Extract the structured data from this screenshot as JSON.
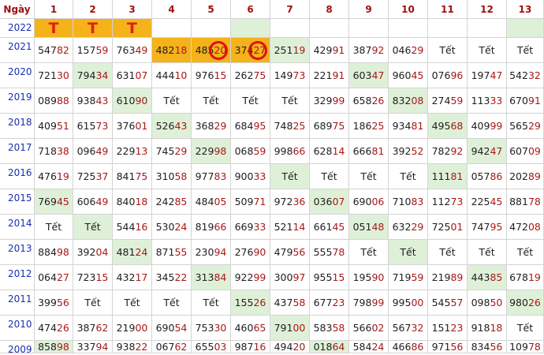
{
  "header": {
    "ngay_label": "Ngày",
    "days": [
      "1",
      "2",
      "3",
      "4",
      "5",
      "6",
      "7",
      "8",
      "9",
      "10",
      "11",
      "12",
      "13"
    ]
  },
  "colors": {
    "accent_text": "#a81818",
    "year_text": "#1a2fb0",
    "highlight_green": "#dff0d8",
    "highlight_orange": "#f5b21a",
    "circle": "#e01010"
  },
  "rows": [
    {
      "year": "2022",
      "cells": [
        {
          "t": "T",
          "c": "orange",
          "big": true
        },
        {
          "t": "T",
          "c": "orange",
          "big": true
        },
        {
          "t": "T",
          "c": "orange",
          "big": true
        },
        {
          "t": ""
        },
        {
          "t": ""
        },
        {
          "t": "",
          "c": "green"
        },
        {
          "t": ""
        },
        {
          "t": ""
        },
        {
          "t": ""
        },
        {
          "t": ""
        },
        {
          "t": ""
        },
        {
          "t": ""
        },
        {
          "t": "",
          "c": "green"
        }
      ]
    },
    {
      "year": "2021",
      "cells": [
        {
          "a": "547",
          "b": "82"
        },
        {
          "a": "157",
          "b": "59"
        },
        {
          "a": "763",
          "b": "49"
        },
        {
          "a": "482",
          "b": "18",
          "c": "orange"
        },
        {
          "a": "485",
          "b": "20",
          "c": "orange",
          "circle": true
        },
        {
          "a": "374",
          "b": "27",
          "c": "orange",
          "circle": true
        },
        {
          "a": "251",
          "b": "19",
          "c": "green"
        },
        {
          "a": "429",
          "b": "91"
        },
        {
          "a": "387",
          "b": "92"
        },
        {
          "a": "046",
          "b": "29"
        },
        {
          "t": "Tết"
        },
        {
          "t": "Tết"
        },
        {
          "t": "Tết"
        }
      ]
    },
    {
      "year": "2020",
      "cells": [
        {
          "a": "721",
          "b": "30"
        },
        {
          "a": "794",
          "b": "34",
          "c": "green"
        },
        {
          "a": "631",
          "b": "07"
        },
        {
          "a": "444",
          "b": "10"
        },
        {
          "a": "976",
          "b": "15"
        },
        {
          "a": "262",
          "b": "75"
        },
        {
          "a": "149",
          "b": "73"
        },
        {
          "a": "221",
          "b": "91"
        },
        {
          "a": "603",
          "b": "47",
          "c": "green"
        },
        {
          "a": "960",
          "b": "45"
        },
        {
          "a": "076",
          "b": "96"
        },
        {
          "a": "197",
          "b": "47"
        },
        {
          "a": "542",
          "b": "32"
        }
      ]
    },
    {
      "year": "2019",
      "cells": [
        {
          "a": "089",
          "b": "88"
        },
        {
          "a": "938",
          "b": "43"
        },
        {
          "a": "610",
          "b": "90",
          "c": "green"
        },
        {
          "t": "Tết"
        },
        {
          "t": "Tết"
        },
        {
          "t": "Tết"
        },
        {
          "t": "Tết"
        },
        {
          "a": "329",
          "b": "99"
        },
        {
          "a": "658",
          "b": "26"
        },
        {
          "a": "832",
          "b": "08",
          "c": "green"
        },
        {
          "a": "274",
          "b": "59"
        },
        {
          "a": "113",
          "b": "33"
        },
        {
          "a": "670",
          "b": "91"
        }
      ]
    },
    {
      "year": "2018",
      "cells": [
        {
          "a": "409",
          "b": "51"
        },
        {
          "a": "615",
          "b": "73"
        },
        {
          "a": "376",
          "b": "01"
        },
        {
          "a": "526",
          "b": "43",
          "c": "green"
        },
        {
          "a": "368",
          "b": "29"
        },
        {
          "a": "684",
          "b": "95"
        },
        {
          "a": "748",
          "b": "25"
        },
        {
          "a": "689",
          "b": "75"
        },
        {
          "a": "186",
          "b": "25"
        },
        {
          "a": "934",
          "b": "81"
        },
        {
          "a": "495",
          "b": "68",
          "c": "green"
        },
        {
          "a": "409",
          "b": "99"
        },
        {
          "a": "565",
          "b": "29"
        }
      ]
    },
    {
      "year": "2017",
      "cells": [
        {
          "a": "718",
          "b": "38"
        },
        {
          "a": "096",
          "b": "49"
        },
        {
          "a": "229",
          "b": "13"
        },
        {
          "a": "745",
          "b": "29"
        },
        {
          "a": "229",
          "b": "98",
          "c": "green"
        },
        {
          "a": "068",
          "b": "59"
        },
        {
          "a": "998",
          "b": "66"
        },
        {
          "a": "628",
          "b": "14"
        },
        {
          "a": "666",
          "b": "81"
        },
        {
          "a": "392",
          "b": "52"
        },
        {
          "a": "782",
          "b": "92"
        },
        {
          "a": "942",
          "b": "47",
          "c": "green"
        },
        {
          "a": "607",
          "b": "09"
        }
      ]
    },
    {
      "year": "2016",
      "cells": [
        {
          "a": "476",
          "b": "19"
        },
        {
          "a": "725",
          "b": "37"
        },
        {
          "a": "841",
          "b": "75"
        },
        {
          "a": "310",
          "b": "58"
        },
        {
          "a": "977",
          "b": "83"
        },
        {
          "a": "900",
          "b": "33"
        },
        {
          "t": "Tết",
          "c": "green"
        },
        {
          "t": "Tết"
        },
        {
          "t": "Tết"
        },
        {
          "t": "Tết"
        },
        {
          "a": "111",
          "b": "81",
          "c": "green"
        },
        {
          "a": "057",
          "b": "86"
        },
        {
          "a": "202",
          "b": "89"
        }
      ]
    },
    {
      "year": "2015",
      "cells": [
        {
          "a": "769",
          "b": "45",
          "c": "green"
        },
        {
          "a": "606",
          "b": "49"
        },
        {
          "a": "840",
          "b": "18"
        },
        {
          "a": "242",
          "b": "85"
        },
        {
          "a": "484",
          "b": "05"
        },
        {
          "a": "509",
          "b": "71"
        },
        {
          "a": "972",
          "b": "36"
        },
        {
          "a": "036",
          "b": "07",
          "c": "green"
        },
        {
          "a": "690",
          "b": "06"
        },
        {
          "a": "710",
          "b": "83"
        },
        {
          "a": "112",
          "b": "73"
        },
        {
          "a": "225",
          "b": "45"
        },
        {
          "a": "881",
          "b": "78"
        }
      ]
    },
    {
      "year": "2014",
      "cells": [
        {
          "t": "Tết"
        },
        {
          "t": "Tết",
          "c": "green"
        },
        {
          "a": "544",
          "b": "16"
        },
        {
          "a": "530",
          "b": "24"
        },
        {
          "a": "819",
          "b": "66"
        },
        {
          "a": "669",
          "b": "33"
        },
        {
          "a": "521",
          "b": "14"
        },
        {
          "a": "661",
          "b": "45"
        },
        {
          "a": "051",
          "b": "48",
          "c": "green"
        },
        {
          "a": "632",
          "b": "29"
        },
        {
          "a": "725",
          "b": "01"
        },
        {
          "a": "747",
          "b": "95"
        },
        {
          "a": "472",
          "b": "08"
        }
      ]
    },
    {
      "year": "2013",
      "cells": [
        {
          "a": "884",
          "b": "98"
        },
        {
          "a": "392",
          "b": "04"
        },
        {
          "a": "481",
          "b": "24",
          "c": "green"
        },
        {
          "a": "871",
          "b": "55"
        },
        {
          "a": "230",
          "b": "94"
        },
        {
          "a": "276",
          "b": "90"
        },
        {
          "a": "479",
          "b": "56"
        },
        {
          "a": "555",
          "b": "78"
        },
        {
          "t": "Tết"
        },
        {
          "t": "Tết",
          "c": "green"
        },
        {
          "t": "Tết"
        },
        {
          "t": "Tết"
        },
        {
          "t": "Tết"
        }
      ]
    },
    {
      "year": "2012",
      "cells": [
        {
          "a": "064",
          "b": "27"
        },
        {
          "a": "723",
          "b": "15"
        },
        {
          "a": "432",
          "b": "17"
        },
        {
          "a": "345",
          "b": "22"
        },
        {
          "a": "313",
          "b": "84",
          "c": "green"
        },
        {
          "a": "922",
          "b": "99"
        },
        {
          "a": "300",
          "b": "97"
        },
        {
          "a": "955",
          "b": "15"
        },
        {
          "a": "195",
          "b": "90"
        },
        {
          "a": "719",
          "b": "59"
        },
        {
          "a": "219",
          "b": "89"
        },
        {
          "a": "443",
          "b": "85",
          "c": "green"
        },
        {
          "a": "678",
          "b": "19"
        }
      ]
    },
    {
      "year": "2011",
      "cells": [
        {
          "a": "399",
          "b": "56"
        },
        {
          "t": "Tết"
        },
        {
          "t": "Tết"
        },
        {
          "t": "Tết"
        },
        {
          "t": "Tết"
        },
        {
          "a": "155",
          "b": "26",
          "c": "green"
        },
        {
          "a": "437",
          "b": "58"
        },
        {
          "a": "677",
          "b": "23"
        },
        {
          "a": "798",
          "b": "99"
        },
        {
          "a": "995",
          "b": "00"
        },
        {
          "a": "545",
          "b": "57"
        },
        {
          "a": "098",
          "b": "50"
        },
        {
          "a": "980",
          "b": "26",
          "c": "green"
        }
      ]
    },
    {
      "year": "2010",
      "cells": [
        {
          "a": "474",
          "b": "26"
        },
        {
          "a": "387",
          "b": "62"
        },
        {
          "a": "219",
          "b": "00"
        },
        {
          "a": "690",
          "b": "54"
        },
        {
          "a": "753",
          "b": "30"
        },
        {
          "a": "460",
          "b": "65"
        },
        {
          "a": "791",
          "b": "00",
          "c": "green"
        },
        {
          "a": "583",
          "b": "58"
        },
        {
          "a": "566",
          "b": "02"
        },
        {
          "a": "567",
          "b": "32"
        },
        {
          "a": "151",
          "b": "23"
        },
        {
          "a": "918",
          "b": "18"
        },
        {
          "t": "Tết"
        }
      ]
    },
    {
      "year": "2009",
      "cells": [
        {
          "a": "858",
          "b": "98",
          "c": "green"
        },
        {
          "a": "337",
          "b": "94"
        },
        {
          "a": "938",
          "b": "22"
        },
        {
          "a": "067",
          "b": "62"
        },
        {
          "a": "655",
          "b": "03"
        },
        {
          "a": "987",
          "b": "16"
        },
        {
          "a": "494",
          "b": "20"
        },
        {
          "a": "018",
          "b": "64",
          "c": "green"
        },
        {
          "a": "584",
          "b": "24"
        },
        {
          "a": "466",
          "b": "86"
        },
        {
          "a": "971",
          "b": "56"
        },
        {
          "a": "834",
          "b": "56"
        },
        {
          "a": "109",
          "b": "78"
        }
      ]
    }
  ]
}
